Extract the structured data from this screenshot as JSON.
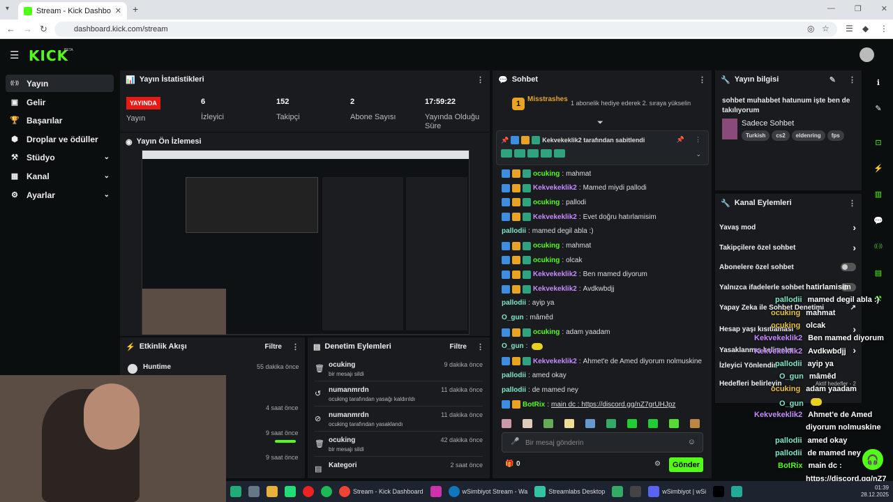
{
  "browser": {
    "tab_title": "Stream - Kick Dashboard",
    "url": "dashboard.kick.com/stream"
  },
  "brand": {
    "logo": "KICK",
    "beta": "BETA",
    "accent": "#53fc18"
  },
  "nav": {
    "items": [
      {
        "label": "Yayın",
        "icon": "signal-icon"
      },
      {
        "label": "Gelir",
        "icon": "money-icon"
      },
      {
        "label": "Başarılar",
        "icon": "trophy-icon"
      },
      {
        "label": "Droplar ve ödüller",
        "icon": "gift-icon"
      },
      {
        "label": "Stüdyo",
        "icon": "studio-icon"
      },
      {
        "label": "Kanal",
        "icon": "channel-icon"
      },
      {
        "label": "Ayarlar",
        "icon": "gear-icon"
      }
    ]
  },
  "stats": {
    "title": "Yayın İstatistikleri",
    "live_badge": "YAYINDA",
    "live_label": "Yayın",
    "viewers": "6",
    "viewers_label": "İzleyici",
    "followers": "152",
    "followers_label": "Takipçi",
    "subs": "2",
    "subs_label": "Abone Sayısı",
    "uptime": "17:59:22",
    "uptime_label": "Yayında Olduğu Süre"
  },
  "preview": {
    "title": "Yayın Ön İzlemesi"
  },
  "feed": {
    "title": "Etkinlik Akışı",
    "filter": "Filtre",
    "items": [
      {
        "name": "Huntime",
        "time": "55 dakika önce"
      },
      {
        "name": "",
        "time": "4 saat önce"
      },
      {
        "name": "",
        "time": "9 saat önce"
      },
      {
        "name": "",
        "time": "9 saat önce"
      }
    ]
  },
  "moderation": {
    "title": "Denetim Eylemleri",
    "filter": "Filtre",
    "items": [
      {
        "user": "ocuking",
        "desc": "bir mesajı sildi",
        "time": "9 dakika önce"
      },
      {
        "user": "numanmrdn",
        "desc": "ocuking tarafından yasağı kaldırıldı",
        "time": "11 dakika önce"
      },
      {
        "user": "numanmrdn",
        "desc": "ocuking tarafından yasaklandı",
        "time": "11 dakika önce"
      },
      {
        "user": "ocuking",
        "desc": "bir mesajı sildi",
        "time": "42 dakika önce"
      },
      {
        "user": "Kategori",
        "desc": "",
        "time": "2 saat önce"
      }
    ]
  },
  "chat": {
    "title": "Sohbet",
    "top_user": "Misstrashes",
    "top_rank": "1",
    "gift_text": "1 abonelik hediye ederek 2. sıraya yükselin",
    "pinned_by": "Kekvekeklik2 tarafından sabitlendi",
    "placeholder": "Bir mesaj gönderin",
    "points": "0",
    "send": "Gönder",
    "messages": [
      {
        "user": "ocuking",
        "text": "mahmat",
        "color": "ugreen",
        "badges": 3
      },
      {
        "user": "Kekvekeklik2",
        "text": "Mamed miydi pallodi",
        "color": "upurple",
        "badges": 3
      },
      {
        "user": "ocuking",
        "text": "pallodi",
        "color": "ugreen",
        "badges": 3
      },
      {
        "user": "Kekvekeklik2",
        "text": "Evet doğru hatırlamisim",
        "color": "upurple",
        "badges": 3
      },
      {
        "user": "pallodii",
        "text": "mamed degil abla :)",
        "color": "uteal",
        "badges": 0
      },
      {
        "user": "ocuking",
        "text": "mahmat",
        "color": "ugreen",
        "badges": 3
      },
      {
        "user": "ocuking",
        "text": "olcak",
        "color": "ugreen",
        "badges": 3
      },
      {
        "user": "Kekvekeklik2",
        "text": "Ben mamed diyorum",
        "color": "upurple",
        "badges": 3
      },
      {
        "user": "Kekvekeklik2",
        "text": "Avdkwbdjj",
        "color": "upurple",
        "badges": 3
      },
      {
        "user": "pallodii",
        "text": "ayip ya",
        "color": "uteal",
        "badges": 0
      },
      {
        "user": "O_gun",
        "text": "mâmêd",
        "color": "uteal",
        "badges": 0
      },
      {
        "user": "ocuking",
        "text": "adam yaadam",
        "color": "ugreen",
        "badges": 3
      },
      {
        "user": "O_gun",
        "text": "",
        "color": "uteal",
        "badges": 0
      },
      {
        "user": "Kekvekeklik2",
        "text": "Ahmet'e de Amed diyorum nolmuskine",
        "color": "upurple",
        "badges": 3
      },
      {
        "user": "pallodii",
        "text": "amed okay",
        "color": "uteal",
        "badges": 0
      },
      {
        "user": "pallodii",
        "text": "de mamed ney",
        "color": "uteal",
        "badges": 0
      },
      {
        "user": "BotRix",
        "text": "main dc : https://discord.gg/nZ7grUHJpz",
        "color": "ugreen",
        "badges": 2
      }
    ]
  },
  "info": {
    "title": "Yayın bilgisi",
    "stream_title": "sohbet muhabbet hatunum işte ben de takılıyorum",
    "category": "Sadece Sohbet",
    "tags": [
      "Turkish",
      "cs2",
      "eldenring",
      "fps"
    ]
  },
  "actions": {
    "title": "Kanal Eylemleri",
    "items": [
      {
        "label": "Yavaş mod",
        "type": "chevron"
      },
      {
        "label": "Takipçilere özel sohbet",
        "type": "chevron"
      },
      {
        "label": "Abonelere özel sohbet",
        "type": "toggle"
      },
      {
        "label": "Yalnızca ifadelerle sohbet",
        "type": "toggle"
      },
      {
        "label": "Yapay Zeka ile Sohbet Denetimi",
        "type": "link"
      },
      {
        "label": "Hesap yaşı kısıtlaması",
        "type": "chevron"
      },
      {
        "label": "Yasaklanmış kelimeler",
        "type": "chevron"
      },
      {
        "label": "İzleyici Yönlendir",
        "type": "none"
      },
      {
        "label": "Hedefleri belirleyin",
        "type": "goals"
      }
    ],
    "goals_sub": "Aktif hedefler - 2"
  },
  "overlay": [
    {
      "user": "",
      "text": "hatirlamisim"
    },
    {
      "user": "pallodii",
      "text": "mamed degil abla :)"
    },
    {
      "user": "ocuking",
      "text": "mahmat"
    },
    {
      "user": "ocuking",
      "text": "olcak"
    },
    {
      "user": "Kekvekeklik2",
      "text": "Ben mamed diyorum"
    },
    {
      "user": "Kekvekeklik2",
      "text": "Avdkwbdjj"
    },
    {
      "user": "pallodii",
      "text": "ayip ya"
    },
    {
      "user": "O_gun",
      "text": "mâmêd"
    },
    {
      "user": "ocuking",
      "text": "adam yaadam"
    },
    {
      "user": "O_gun",
      "text": ""
    },
    {
      "user": "Kekvekeklik2",
      "text": "Ahmet'e de Amed"
    },
    {
      "user": "",
      "text": "diyorum nolmuskine"
    },
    {
      "user": "pallodii",
      "text": "amed okay"
    },
    {
      "user": "pallodii",
      "text": "de mamed ney"
    },
    {
      "user": "BotRix",
      "text": "main dc :"
    },
    {
      "user": "",
      "text": "https://discord.gg/nZ7"
    },
    {
      "user": "",
      "text": "grUHJpz"
    }
  ],
  "taskbar": {
    "apps": [
      "Stream - Kick Dashboard",
      "wSimbiyot Stream - Wa",
      "Streamlabs Desktop",
      "wSimbiyot | wSi"
    ],
    "time": "01:39",
    "date": "28.12.2025"
  }
}
